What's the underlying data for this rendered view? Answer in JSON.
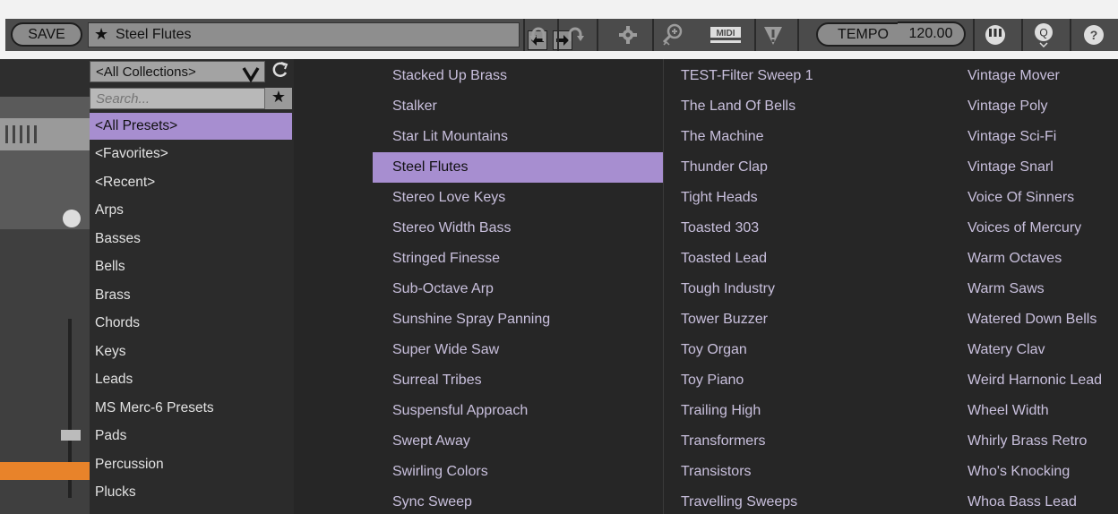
{
  "toolbar": {
    "save_label": "SAVE",
    "preset_star": "★",
    "preset_name": "Steel Flutes",
    "tempo_label": "TEMPO",
    "tempo_value": "120.00",
    "midi_label": "MIDI",
    "help_label": "?",
    "q_label": "Q",
    "icons": [
      "arrow-left",
      "arrow-right",
      "undo",
      "redo",
      "settings-gear",
      "zoom",
      "midi",
      "alert",
      "tempo",
      "piano-keys",
      "quantize",
      "help"
    ]
  },
  "collections": {
    "dropdown_value": "<All Collections>",
    "search_placeholder": "Search...",
    "pin_glyph": "★",
    "items": [
      "<All Presets>",
      "<Favorites>",
      "<Recent>",
      "Arps",
      "Basses",
      "Bells",
      "Brass",
      "Chords",
      "Keys",
      "Leads",
      "MS Merc-6 Presets",
      "Pads",
      "Percussion",
      "Plucks"
    ],
    "selected_index": 0
  },
  "presets": {
    "columns": [
      [
        "Stacked Up Brass",
        "Stalker",
        "Star Lit Mountains",
        "Steel Flutes",
        "Stereo Love Keys",
        "Stereo Width Bass",
        "Stringed Finesse",
        "Sub-Octave Arp",
        "Sunshine Spray Panning",
        "Super Wide Saw",
        "Surreal Tribes",
        "Suspensful Approach",
        "Swept Away",
        "Swirling Colors",
        "Sync Sweep"
      ],
      [
        "TEST-Filter Sweep 1",
        "The Land Of Bells",
        "The Machine",
        "Thunder Clap",
        "Tight Heads",
        "Toasted 303",
        "Toasted Lead",
        "Tough Industry",
        "Tower Buzzer",
        "Toy Organ",
        "Toy Piano",
        "Trailing High",
        "Transformers",
        "Transistors",
        "Travelling Sweeps"
      ],
      [
        "Vintage Mover",
        "Vintage Poly",
        "Vintage Sci-Fi",
        "Vintage Snarl",
        "Voice Of Sinners",
        "Voices of Mercury",
        "Warm Octaves",
        "Warm Saws",
        "Watered Down Bells",
        "Watery Clav",
        "Weird Harnonic Lead",
        "Wheel Width",
        "Whirly Brass Retro",
        "Who's Knocking",
        "Whoa Bass Lead"
      ]
    ],
    "selected": "Steel Flutes"
  },
  "colors": {
    "selection": "#a78ed0",
    "list_text": "#c9c0dd",
    "toolbar": "#4b4b4b",
    "background": "#262626"
  }
}
